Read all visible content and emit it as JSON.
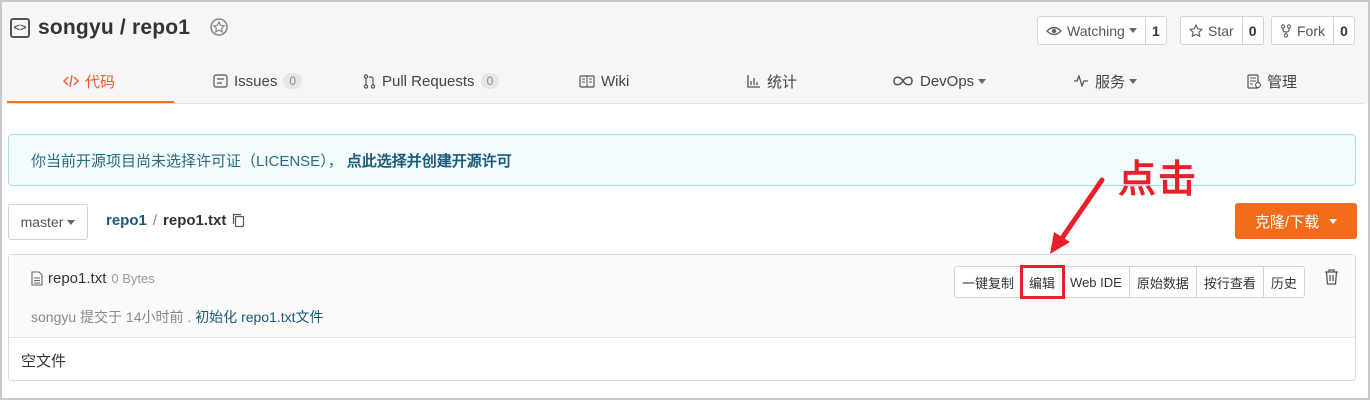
{
  "repo": {
    "owner": "songyu",
    "separator": "/",
    "name": "repo1",
    "full_title": "songyu / repo1"
  },
  "actions": {
    "watch": {
      "label": "Watching",
      "count": "1"
    },
    "star": {
      "label": "Star",
      "count": "0"
    },
    "fork": {
      "label": "Fork",
      "count": "0"
    }
  },
  "tabs": [
    {
      "label": "代码",
      "icon": "code-icon",
      "active": true
    },
    {
      "label": "Issues",
      "count": "0",
      "icon": "issues-icon"
    },
    {
      "label": "Pull Requests",
      "count": "0",
      "icon": "pull-request-icon"
    },
    {
      "label": "Wiki",
      "icon": "wiki-icon"
    },
    {
      "label": "统计",
      "icon": "chart-icon"
    },
    {
      "label": "DevOps",
      "icon": "infinity-icon"
    },
    {
      "label": "服务",
      "icon": "pulse-icon"
    },
    {
      "label": "管理",
      "icon": "manage-icon"
    }
  ],
  "notice": {
    "text": "你当前开源项目尚未选择许可证（LICENSE），",
    "link": "点此选择并创建开源许可"
  },
  "branch": {
    "name": "master"
  },
  "breadcrumb": {
    "repo": "repo1",
    "sep": "/",
    "file": "repo1.txt"
  },
  "clone_button": "克隆/下载",
  "annotation": {
    "text": "点击",
    "color": "#e8202a"
  },
  "file": {
    "name": "repo1.txt",
    "size": "0 Bytes",
    "commit_author": "songyu",
    "commit_text": "提交于 14小时前 .",
    "commit_message": "初始化 repo1.txt文件",
    "content": "空文件"
  },
  "file_actions": [
    "一键复制",
    "编辑",
    "Web IDE",
    "原始数据",
    "按行查看",
    "历史"
  ],
  "colors": {
    "accent": "#f05a28",
    "clone": "#f46b18",
    "link": "#19597a"
  }
}
